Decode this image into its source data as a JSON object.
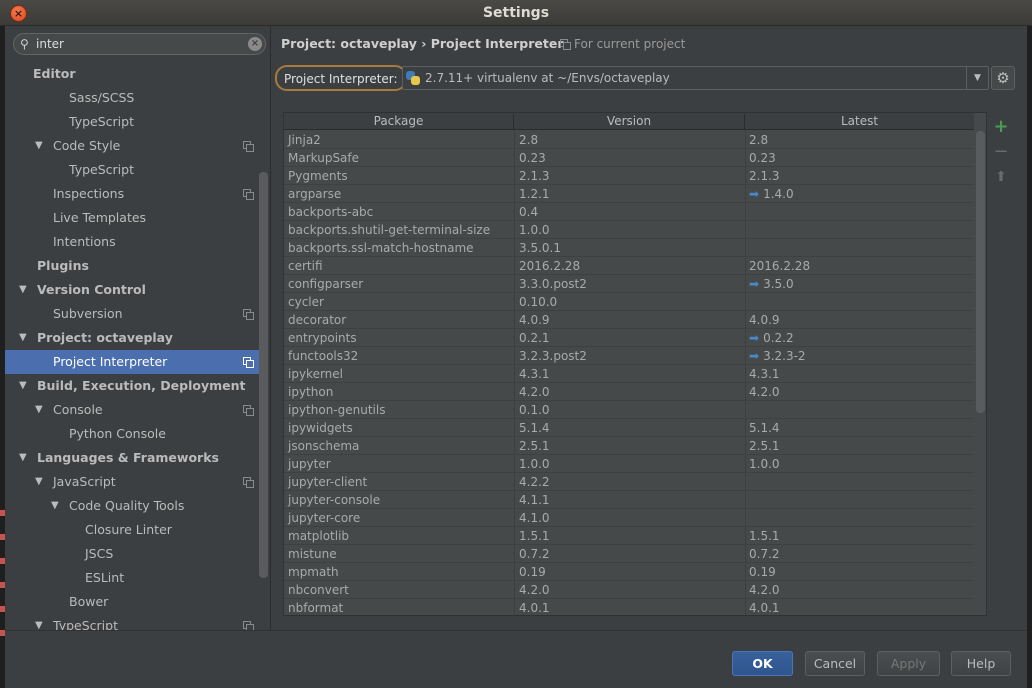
{
  "window": {
    "title": "Settings"
  },
  "search": {
    "value": "inter"
  },
  "tree": [
    {
      "label": "Editor",
      "level": 0,
      "bold": true,
      "arrow": "",
      "copy": false
    },
    {
      "label": "Sass/SCSS",
      "level": 3,
      "bold": false,
      "arrow": "",
      "copy": false
    },
    {
      "label": "TypeScript",
      "level": 3,
      "bold": false,
      "arrow": "",
      "copy": false
    },
    {
      "label": "Code Style",
      "level": 2,
      "bold": false,
      "arrow": "▼",
      "copy": true
    },
    {
      "label": "TypeScript",
      "level": 3,
      "bold": false,
      "arrow": "",
      "copy": false
    },
    {
      "label": "Inspections",
      "level": 2,
      "bold": false,
      "arrow": "",
      "copy": true
    },
    {
      "label": "Live Templates",
      "level": 2,
      "bold": false,
      "arrow": "",
      "copy": false
    },
    {
      "label": "Intentions",
      "level": 2,
      "bold": false,
      "arrow": "",
      "copy": false
    },
    {
      "label": "Plugins",
      "level": 1,
      "bold": true,
      "arrow": "",
      "copy": false
    },
    {
      "label": "Version Control",
      "level": 1,
      "bold": true,
      "arrow": "▼",
      "copy": false
    },
    {
      "label": "Subversion",
      "level": 2,
      "bold": false,
      "arrow": "",
      "copy": true
    },
    {
      "label": "Project: octaveplay",
      "level": 1,
      "bold": true,
      "arrow": "▼",
      "copy": false
    },
    {
      "label": "Project Interpreter",
      "level": 2,
      "bold": false,
      "arrow": "",
      "copy": true,
      "selected": true
    },
    {
      "label": "Build, Execution, Deployment",
      "level": 1,
      "bold": true,
      "arrow": "▼",
      "copy": false
    },
    {
      "label": "Console",
      "level": 2,
      "bold": false,
      "arrow": "▼",
      "copy": true
    },
    {
      "label": "Python Console",
      "level": 3,
      "bold": false,
      "arrow": "",
      "copy": false
    },
    {
      "label": "Languages & Frameworks",
      "level": 1,
      "bold": true,
      "arrow": "▼",
      "copy": false
    },
    {
      "label": "JavaScript",
      "level": 2,
      "bold": false,
      "arrow": "▼",
      "copy": true
    },
    {
      "label": "Code Quality Tools",
      "level": 3,
      "bold": false,
      "arrow": "▼",
      "copy": false
    },
    {
      "label": "Closure Linter",
      "level": 4,
      "bold": false,
      "arrow": "",
      "copy": false
    },
    {
      "label": "JSCS",
      "level": 4,
      "bold": false,
      "arrow": "",
      "copy": false
    },
    {
      "label": "ESLint",
      "level": 4,
      "bold": false,
      "arrow": "",
      "copy": false
    },
    {
      "label": "Bower",
      "level": 3,
      "bold": false,
      "arrow": "",
      "copy": false
    },
    {
      "label": "TypeScript",
      "level": 2,
      "bold": false,
      "arrow": "▼",
      "copy": true
    }
  ],
  "main": {
    "breadcrumb": "Project: octaveplay › Project Interpreter",
    "for_current": "For current project",
    "interpreter_label": "Project Interpreter:",
    "interpreter_value": "2.7.11+ virtualenv at ~/Envs/octaveplay"
  },
  "table": {
    "headers": [
      "Package",
      "Version",
      "Latest"
    ],
    "rows": [
      {
        "package": "Jinja2",
        "version": "2.8",
        "latest": "2.8",
        "update": false
      },
      {
        "package": "MarkupSafe",
        "version": "0.23",
        "latest": "0.23",
        "update": false
      },
      {
        "package": "Pygments",
        "version": "2.1.3",
        "latest": "2.1.3",
        "update": false
      },
      {
        "package": "argparse",
        "version": "1.2.1",
        "latest": "1.4.0",
        "update": true
      },
      {
        "package": "backports-abc",
        "version": "0.4",
        "latest": "",
        "update": false
      },
      {
        "package": "backports.shutil-get-terminal-size",
        "version": "1.0.0",
        "latest": "",
        "update": false
      },
      {
        "package": "backports.ssl-match-hostname",
        "version": "3.5.0.1",
        "latest": "",
        "update": false
      },
      {
        "package": "certifi",
        "version": "2016.2.28",
        "latest": "2016.2.28",
        "update": false
      },
      {
        "package": "configparser",
        "version": "3.3.0.post2",
        "latest": "3.5.0",
        "update": true
      },
      {
        "package": "cycler",
        "version": "0.10.0",
        "latest": "",
        "update": false
      },
      {
        "package": "decorator",
        "version": "4.0.9",
        "latest": "4.0.9",
        "update": false
      },
      {
        "package": "entrypoints",
        "version": "0.2.1",
        "latest": "0.2.2",
        "update": true
      },
      {
        "package": "functools32",
        "version": "3.2.3.post2",
        "latest": "3.2.3-2",
        "update": true
      },
      {
        "package": "ipykernel",
        "version": "4.3.1",
        "latest": "4.3.1",
        "update": false
      },
      {
        "package": "ipython",
        "version": "4.2.0",
        "latest": "4.2.0",
        "update": false
      },
      {
        "package": "ipython-genutils",
        "version": "0.1.0",
        "latest": "",
        "update": false
      },
      {
        "package": "ipywidgets",
        "version": "5.1.4",
        "latest": "5.1.4",
        "update": false
      },
      {
        "package": "jsonschema",
        "version": "2.5.1",
        "latest": "2.5.1",
        "update": false
      },
      {
        "package": "jupyter",
        "version": "1.0.0",
        "latest": "1.0.0",
        "update": false
      },
      {
        "package": "jupyter-client",
        "version": "4.2.2",
        "latest": "",
        "update": false
      },
      {
        "package": "jupyter-console",
        "version": "4.1.1",
        "latest": "",
        "update": false
      },
      {
        "package": "jupyter-core",
        "version": "4.1.0",
        "latest": "",
        "update": false
      },
      {
        "package": "matplotlib",
        "version": "1.5.1",
        "latest": "1.5.1",
        "update": false
      },
      {
        "package": "mistune",
        "version": "0.7.2",
        "latest": "0.7.2",
        "update": false
      },
      {
        "package": "mpmath",
        "version": "0.19",
        "latest": "0.19",
        "update": false
      },
      {
        "package": "nbconvert",
        "version": "4.2.0",
        "latest": "4.2.0",
        "update": false
      },
      {
        "package": "nbformat",
        "version": "4.0.1",
        "latest": "4.0.1",
        "update": false
      }
    ]
  },
  "side_buttons": {
    "add": "+",
    "remove": "−",
    "upgrade": "⬆"
  },
  "footer": {
    "ok": "OK",
    "cancel": "Cancel",
    "apply": "Apply",
    "help": "Help"
  },
  "colors": {
    "selection": "#4b6eaf",
    "accent_focus": "#a57b3e",
    "add_green": "#499c54",
    "update_blue": "#4a88c7"
  }
}
